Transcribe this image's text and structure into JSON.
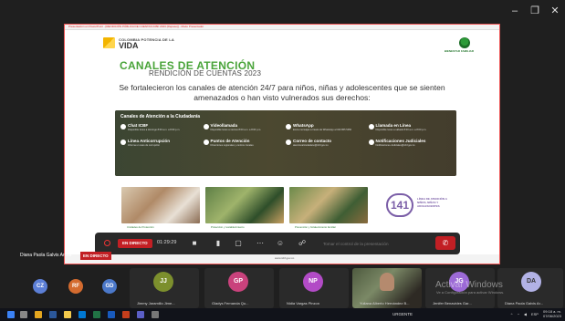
{
  "window": {
    "min": "–",
    "max": "❐",
    "close": "✕"
  },
  "slide": {
    "title_strip": "Presentación en PowerPoint - [RENDICIÓN PÚBLICA DE CUENTAS ICBF 2023 (Repaso)] - Modo Presentador",
    "brand_small": "COLOMBIA POTENCIA DE LA",
    "brand_big": "VIDA",
    "icbf_label": "BIENESTAR FAMILIAR",
    "heading": "CANALES DE ATENCIÓN",
    "subheading": "RENDICIÓN DE CUENTAS 2023",
    "lead": "Se fortalecieron los canales de atención 24/7 para niños, niñas y adolescentes  que se sienten amenazados o han visto vulnerados sus derechos:",
    "panel_title": "Canales de Atención a la Ciudadanía",
    "channels": [
      {
        "name": "Chat ICBF",
        "desc": "Disponible lunes a domingo 8:00 a.m. a 8:00 p.m."
      },
      {
        "name": "Videollamada",
        "desc": "Disponible lunes a viernes 8:00 a.m. a 8:00 p.m."
      },
      {
        "name": "WhatsApp",
        "desc": "Envía mensajes a través de WhatsApp al 320 865 5450"
      },
      {
        "name": "Llamada en Línea",
        "desc": "Disponible lunes a sábado 8:00 a.m. a 8:00 p.m."
      },
      {
        "name": "Línea Anticorrupción",
        "desc": "Informa un caso de corrupción"
      },
      {
        "name": "Puntos de Atención",
        "desc": "Direcciones regionales y centros zonales"
      },
      {
        "name": "Correo de contacto",
        "desc": "atencionalciudadano@icbf.gov.co"
      },
      {
        "name": "Notificaciones Judiciales",
        "desc": "Notificaciones.Judiciales@icbf.gov.co"
      }
    ],
    "photo_captions": [
      "Unidades de Protección",
      "Protección y restablecimiento",
      "Prevención y fortalecimiento familiar"
    ],
    "badge_141": "141",
    "badge_141_text": "LÍNEA DE ATENCIÓN A NIÑOS, NIÑAS Y ADOLESCENTES",
    "footer": "www.icbf.gov.co"
  },
  "controls": {
    "live_label": "EN DIRECTO",
    "timer": "01:29:29",
    "input_placeholder": "Tomar el control de la presentación",
    "hangup": "✆"
  },
  "presenter": {
    "name": "Diana Paola Galvis Arcila",
    "live_label": "EN DIRECTO"
  },
  "avatars_left": [
    {
      "initials": "CZ",
      "color": "#5c7fd6"
    },
    {
      "initials": "RF",
      "color": "#d46b2f"
    },
    {
      "initials": "GD",
      "color": "#4b78c9"
    }
  ],
  "participants": [
    {
      "initials": "JJ",
      "name": "Jimmy Jaramillo Jime...",
      "color": "#7c8f2d"
    },
    {
      "initials": "GP",
      "name": "Gladys Fernanda Qu...",
      "color": "#c9427c"
    },
    {
      "initials": "NP",
      "name": "Nidia Vargas Pinzon",
      "color": "#b24bc6"
    },
    {
      "initials": "",
      "name": "Yuliana Alberto Hernández B...",
      "color": "#000000",
      "video": true
    },
    {
      "initials": "JG",
      "name": "Jenifer Benavides Gar...",
      "color": "#9c6ad6"
    },
    {
      "initials": "DA",
      "name": "Diana Paola Galvis Ar...",
      "color": "#b2b2e6"
    }
  ],
  "watermark": {
    "title": "Activar Windows",
    "sub": "Ve a Configuración para activar Windows."
  },
  "taskbar": {
    "urgent": "URGENTE",
    "lang": "ESP",
    "time": "09:18 a. m.",
    "date": "07/06/2023"
  }
}
